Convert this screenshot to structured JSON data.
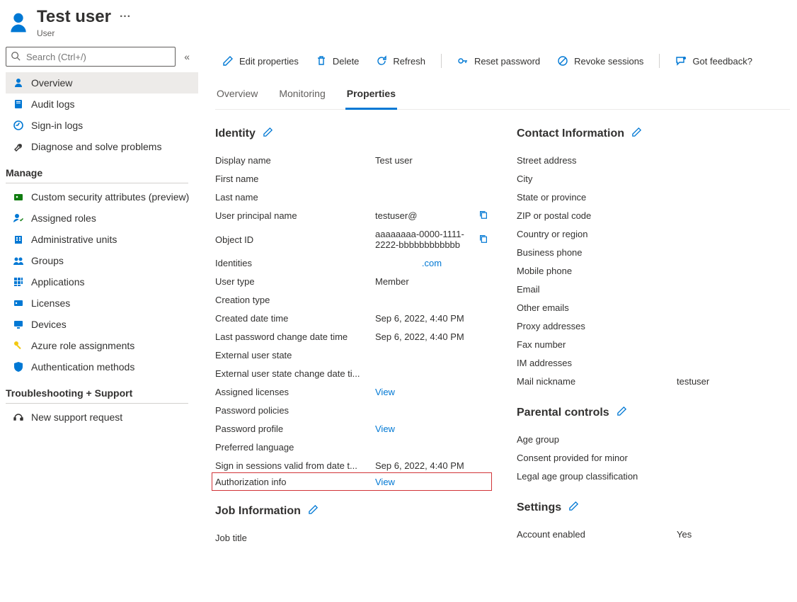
{
  "header": {
    "title": "Test user",
    "subtitle": "User"
  },
  "search": {
    "placeholder": "Search (Ctrl+/)"
  },
  "toolbar": {
    "edit": "Edit properties",
    "delete": "Delete",
    "refresh": "Refresh",
    "reset": "Reset password",
    "revoke": "Revoke sessions",
    "feedback": "Got feedback?"
  },
  "tabs": {
    "overview": "Overview",
    "monitoring": "Monitoring",
    "properties": "Properties"
  },
  "sidebar": {
    "items_top": [
      {
        "label": "Overview"
      },
      {
        "label": "Audit logs"
      },
      {
        "label": "Sign-in logs"
      },
      {
        "label": "Diagnose and solve problems"
      }
    ],
    "manage_header": "Manage",
    "items_manage": [
      {
        "label": "Custom security attributes (preview)"
      },
      {
        "label": "Assigned roles"
      },
      {
        "label": "Administrative units"
      },
      {
        "label": "Groups"
      },
      {
        "label": "Applications"
      },
      {
        "label": "Licenses"
      },
      {
        "label": "Devices"
      },
      {
        "label": "Azure role assignments"
      },
      {
        "label": "Authentication methods"
      }
    ],
    "ts_header": "Troubleshooting + Support",
    "items_ts": [
      {
        "label": "New support request"
      }
    ]
  },
  "sections": {
    "identity": "Identity",
    "jobinfo": "Job Information",
    "contact": "Contact Information",
    "parental": "Parental controls",
    "settings": "Settings"
  },
  "identity": {
    "display_name_l": "Display name",
    "display_name_v": "Test user",
    "first_name_l": "First name",
    "last_name_l": "Last name",
    "upn_l": "User principal name",
    "upn_v": "testuser@",
    "oid_l": "Object ID",
    "oid_v": "aaaaaaaa-0000-1111-2222-bbbbbbbbbbbb",
    "ident_l": "Identities",
    "ident_v": ".com",
    "utype_l": "User type",
    "utype_v": "Member",
    "ctype_l": "Creation type",
    "created_l": "Created date time",
    "created_v": "Sep 6, 2022, 4:40 PM",
    "lastpass_l": "Last password change date time",
    "lastpass_v": "Sep 6, 2022, 4:40 PM",
    "eus_l": "External user state",
    "eusc_l": "External user state change date ti...",
    "alic_l": "Assigned licenses",
    "alic_v": "View",
    "ppol_l": "Password policies",
    "pprof_l": "Password profile",
    "pprof_v": "View",
    "plang_l": "Preferred language",
    "sisv_l": "Sign in sessions valid from date t...",
    "sisv_v": "Sep 6, 2022, 4:40 PM",
    "auth_l": "Authorization info",
    "auth_v": "View"
  },
  "job": {
    "title_l": "Job title"
  },
  "contact": {
    "street_l": "Street address",
    "city_l": "City",
    "state_l": "State or province",
    "zip_l": "ZIP or postal code",
    "country_l": "Country or region",
    "bphone_l": "Business phone",
    "mphone_l": "Mobile phone",
    "email_l": "Email",
    "oemail_l": "Other emails",
    "proxy_l": "Proxy addresses",
    "fax_l": "Fax number",
    "im_l": "IM addresses",
    "mailnick_l": "Mail nickname",
    "mailnick_v": "testuser"
  },
  "parental": {
    "age_l": "Age group",
    "consent_l": "Consent provided for minor",
    "legal_l": "Legal age group classification"
  },
  "settings": {
    "acct_l": "Account enabled",
    "acct_v": "Yes"
  }
}
